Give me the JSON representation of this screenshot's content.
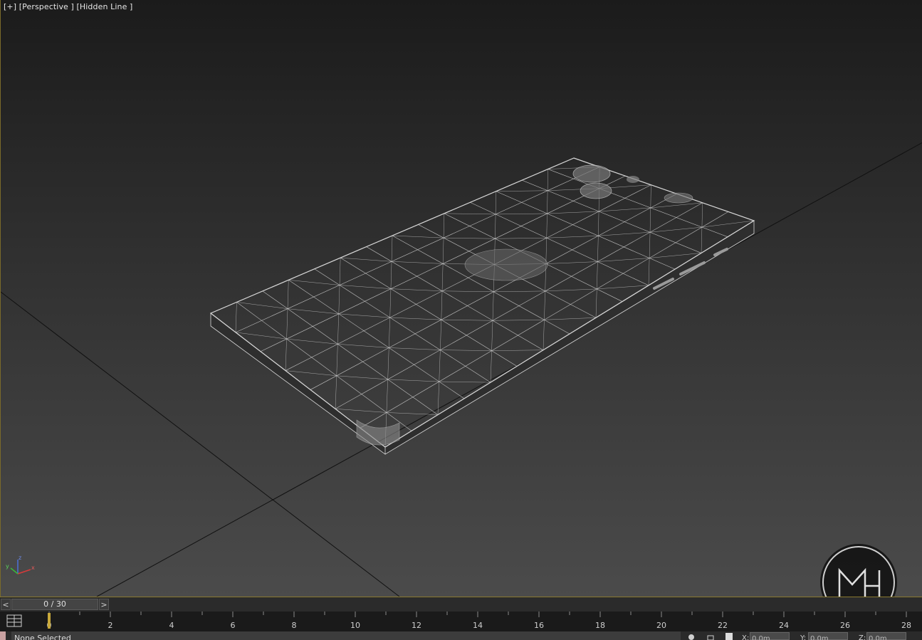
{
  "viewport": {
    "label_plus": "[+]",
    "label_view": "[Perspective ]",
    "label_shading": "[Hidden Line ]",
    "background_top": "#1b1b1b",
    "background_bottom": "#4b4b4b",
    "grid_color": "#111111",
    "wire_color": "#d8d8d8"
  },
  "axis_gizmo": {
    "x": "x",
    "y": "y",
    "z": "z"
  },
  "logo": {
    "text": "MH"
  },
  "time_slider": {
    "prev_label": "<",
    "next_label": ">",
    "value": "0 / 30"
  },
  "trackbar": {
    "ticks": [
      "0",
      "2",
      "4",
      "6",
      "8",
      "10",
      "12",
      "14",
      "16",
      "18",
      "20",
      "22",
      "24",
      "26",
      "28"
    ],
    "current_frame": "0"
  },
  "statusbar": {
    "text": "None Selected",
    "x_label": "X:",
    "x_value": "0.0m",
    "y_label": "Y:",
    "y_value": "0.0m",
    "z_label": "Z:",
    "z_value": "0.0m"
  }
}
